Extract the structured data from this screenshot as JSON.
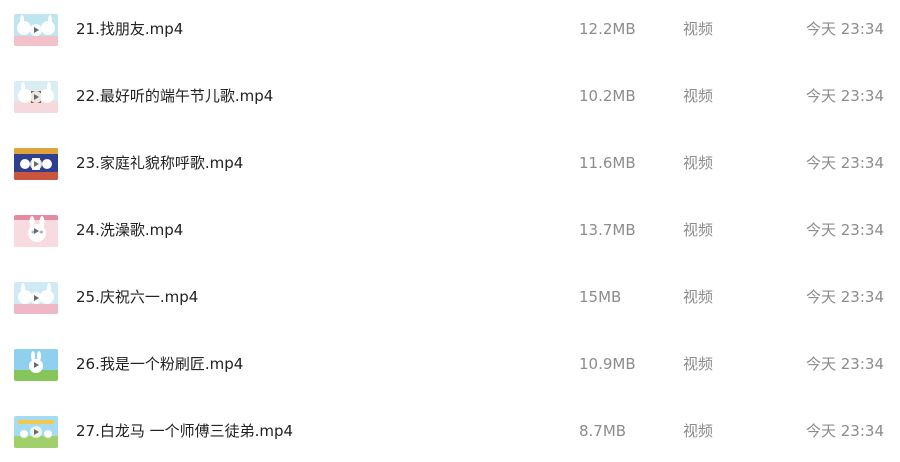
{
  "files": [
    {
      "name": "21.找朋友.mp4",
      "size": "12.2MB",
      "type": "视频",
      "time": "今天 23:34",
      "thumbnail_icon": "video-thumbnail-icon"
    },
    {
      "name": "22.最好听的端午节儿歌.mp4",
      "size": "10.2MB",
      "type": "视频",
      "time": "今天 23:34",
      "thumbnail_icon": "video-thumbnail-icon"
    },
    {
      "name": "23.家庭礼貌称呼歌.mp4",
      "size": "11.6MB",
      "type": "视频",
      "time": "今天 23:34",
      "thumbnail_icon": "video-thumbnail-icon"
    },
    {
      "name": "24.洗澡歌.mp4",
      "size": "13.7MB",
      "type": "视频",
      "time": "今天 23:34",
      "thumbnail_icon": "video-thumbnail-icon"
    },
    {
      "name": "25.庆祝六一.mp4",
      "size": "15MB",
      "type": "视频",
      "time": "今天 23:34",
      "thumbnail_icon": "video-thumbnail-icon"
    },
    {
      "name": "26.我是一个粉刷匠.mp4",
      "size": "10.9MB",
      "type": "视频",
      "time": "今天 23:34",
      "thumbnail_icon": "video-thumbnail-icon"
    },
    {
      "name": "27.白龙马 一个师傅三徒弟.mp4",
      "size": "8.7MB",
      "type": "视频",
      "time": "今天 23:34",
      "thumbnail_icon": "video-thumbnail-icon"
    }
  ],
  "colors": {
    "text_primary": "#222222",
    "text_secondary": "#8c8c8c"
  }
}
